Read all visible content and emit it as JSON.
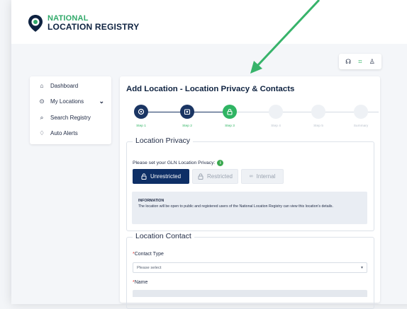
{
  "app": {
    "logo_line1": "NATIONAL",
    "logo_line2": "LOCATION REGISTRY",
    "brand_green": "#31a96a",
    "brand_navy": "#0e2240"
  },
  "util_bar": {
    "icons": [
      "headset-icon",
      "barcode-scan-icon",
      "user-icon"
    ]
  },
  "sidebar": {
    "items": [
      {
        "label": "Dashboard",
        "icon": "home-icon"
      },
      {
        "label": "My Locations",
        "icon": "location-pin-icon",
        "has_chevron": true
      },
      {
        "label": "Search Registry",
        "icon": "search-icon"
      },
      {
        "label": "Auto Alerts",
        "icon": "bell-icon"
      }
    ]
  },
  "main": {
    "title": "Add Location - Location Privacy & Contacts",
    "steps": [
      {
        "label": "Step 1",
        "state": "complete",
        "icon": "location-pin-icon"
      },
      {
        "label": "Step 2",
        "state": "complete",
        "icon": "building-icon"
      },
      {
        "label": "Step 3",
        "state": "current",
        "icon": "lock-icon"
      },
      {
        "label": "Step 4",
        "state": "pending"
      },
      {
        "label": "Step 5",
        "state": "pending"
      },
      {
        "label": "Summary",
        "state": "pending"
      }
    ],
    "privacy": {
      "legend": "Location Privacy",
      "prompt": "Please set your GLN Location Privacy:",
      "options": [
        {
          "label": "Unrestricted",
          "icon": "lock-open-icon",
          "selected": true
        },
        {
          "label": "Restricted",
          "icon": "lock-icon",
          "selected": false
        },
        {
          "label": "Internal",
          "icon": "group-icon",
          "selected": false
        }
      ],
      "info_title": "INFORMATION",
      "info_text": "The location will be open to public and registered users of the National Location Registry can view this location's details."
    },
    "contact": {
      "legend": "Location Contact",
      "contact_type_label": "Contact Type",
      "contact_type_value": "Please select",
      "name_label": "Name",
      "required_mark": "*"
    }
  },
  "colors": {
    "step_navy": "#1a3563",
    "step_green": "#2fb463",
    "step_pending": "#e9edf2",
    "arrow": "#37b36a"
  }
}
